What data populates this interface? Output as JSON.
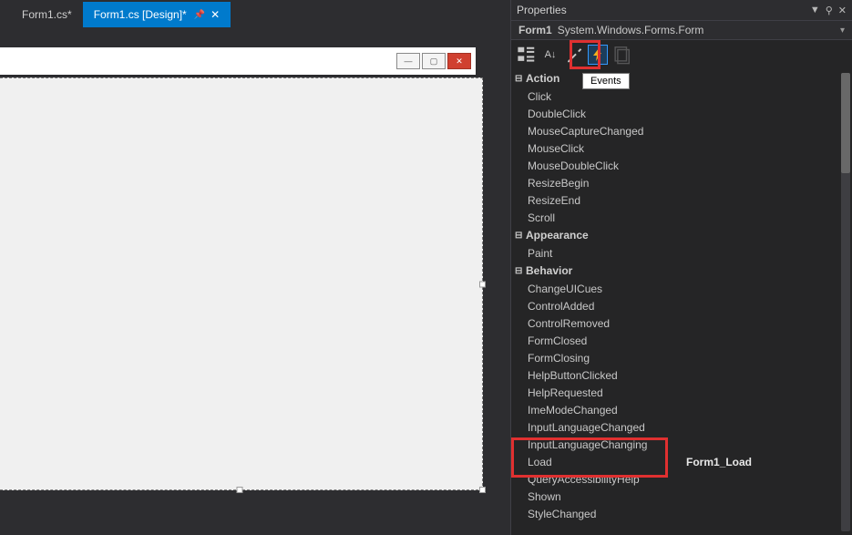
{
  "tabs": [
    {
      "label": "Form1.cs*",
      "active": false
    },
    {
      "label": "Form1.cs [Design]*",
      "active": true
    }
  ],
  "designer": {
    "window_buttons": {
      "min": "—",
      "max": "▢",
      "close": "✕"
    }
  },
  "properties": {
    "panel_title": "Properties",
    "object_name": "Form1",
    "object_type": "System.Windows.Forms.Form",
    "toolbar": {
      "categorized_icon": "categorized",
      "alpha_icon": "A↓",
      "props_icon": "wrench",
      "events_icon": "lightning",
      "pages_icon": "pages"
    },
    "tooltip": "Events",
    "categories": [
      {
        "name": "Action",
        "items": [
          {
            "name": "Click",
            "value": ""
          },
          {
            "name": "DoubleClick",
            "value": ""
          },
          {
            "name": "MouseCaptureChanged",
            "value": ""
          },
          {
            "name": "MouseClick",
            "value": ""
          },
          {
            "name": "MouseDoubleClick",
            "value": ""
          },
          {
            "name": "ResizeBegin",
            "value": ""
          },
          {
            "name": "ResizeEnd",
            "value": ""
          },
          {
            "name": "Scroll",
            "value": ""
          }
        ]
      },
      {
        "name": "Appearance",
        "items": [
          {
            "name": "Paint",
            "value": ""
          }
        ]
      },
      {
        "name": "Behavior",
        "items": [
          {
            "name": "ChangeUICues",
            "value": ""
          },
          {
            "name": "ControlAdded",
            "value": ""
          },
          {
            "name": "ControlRemoved",
            "value": ""
          },
          {
            "name": "FormClosed",
            "value": ""
          },
          {
            "name": "FormClosing",
            "value": ""
          },
          {
            "name": "HelpButtonClicked",
            "value": ""
          },
          {
            "name": "HelpRequested",
            "value": ""
          },
          {
            "name": "ImeModeChanged",
            "value": ""
          },
          {
            "name": "InputLanguageChanged",
            "value": ""
          },
          {
            "name": "InputLanguageChanging",
            "value": ""
          },
          {
            "name": "Load",
            "value": "Form1_Load",
            "highlight": true
          },
          {
            "name": "QueryAccessibilityHelp",
            "value": ""
          },
          {
            "name": "Shown",
            "value": ""
          },
          {
            "name": "StyleChanged",
            "value": ""
          }
        ]
      }
    ]
  },
  "header_icons": {
    "dropdown": "▼",
    "pin": "⚲",
    "close": "✕"
  }
}
